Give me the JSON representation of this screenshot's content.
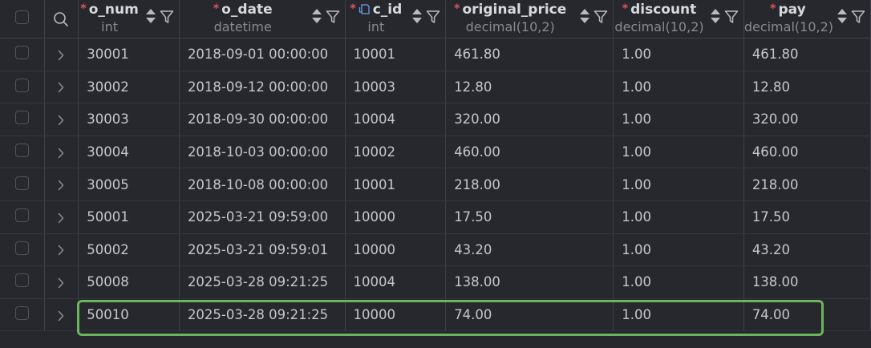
{
  "columns": [
    {
      "name": "o_num",
      "type": "int",
      "required": true,
      "key": false
    },
    {
      "name": "o_date",
      "type": "datetime",
      "required": true,
      "key": false
    },
    {
      "name": "c_id",
      "type": "int",
      "required": true,
      "key": true
    },
    {
      "name": "original_price",
      "type": "decimal(10,2)",
      "required": true,
      "key": false
    },
    {
      "name": "discount",
      "type": "decimal(10,2)",
      "required": true,
      "key": false
    },
    {
      "name": "pay",
      "type": "decimal(10,2)",
      "required": true,
      "key": false
    }
  ],
  "rows": [
    [
      "30001",
      "2018-09-01 00:00:00",
      "10001",
      "461.80",
      "1.00",
      "461.80"
    ],
    [
      "30002",
      "2018-09-12 00:00:00",
      "10003",
      "12.80",
      "1.00",
      "12.80"
    ],
    [
      "30003",
      "2018-09-30 00:00:00",
      "10004",
      "320.00",
      "1.00",
      "320.00"
    ],
    [
      "30004",
      "2018-10-03 00:00:00",
      "10002",
      "460.00",
      "1.00",
      "460.00"
    ],
    [
      "30005",
      "2018-10-08 00:00:00",
      "10001",
      "218.00",
      "1.00",
      "218.00"
    ],
    [
      "50001",
      "2025-03-21 09:59:00",
      "10000",
      "17.50",
      "1.00",
      "17.50"
    ],
    [
      "50002",
      "2025-03-21 09:59:01",
      "10000",
      "43.20",
      "1.00",
      "43.20"
    ],
    [
      "50008",
      "2025-03-28 09:21:25",
      "10004",
      "138.00",
      "1.00",
      "138.00"
    ],
    [
      "50010",
      "2025-03-28 09:21:25",
      "10000",
      "74.00",
      "1.00",
      "74.00"
    ]
  ],
  "highlighted_row": 8,
  "colors": {
    "background": "#26282d",
    "required_marker": "#e0555a",
    "highlight_border": "#6cb55a",
    "key_icon": "#6d9cf0"
  },
  "icons": {
    "search": "search-icon",
    "sort": "sort-icon",
    "filter": "filter-icon",
    "expand": "chevron-right-icon",
    "key": "foreign-key-icon"
  }
}
